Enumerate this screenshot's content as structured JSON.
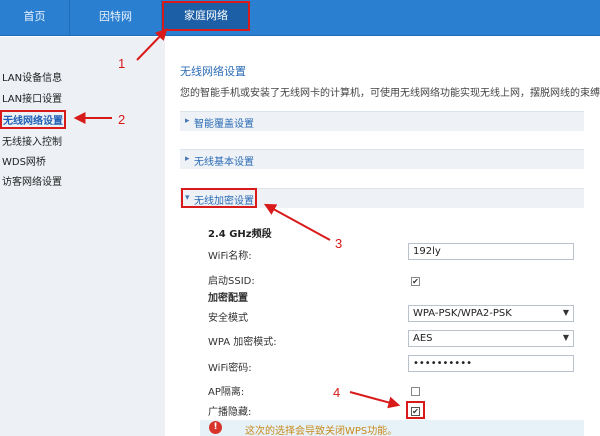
{
  "nav": {
    "tabs": [
      {
        "label": "首页"
      },
      {
        "label": "因特网"
      },
      {
        "label": "家庭网络"
      }
    ]
  },
  "sidebar": {
    "items": [
      {
        "label": "LAN设备信息"
      },
      {
        "label": "LAN接口设置"
      },
      {
        "label": "无线网络设置"
      },
      {
        "label": "无线接入控制"
      },
      {
        "label": "WDS网桥"
      },
      {
        "label": "访客网络设置"
      }
    ]
  },
  "main": {
    "title": "无线网络设置",
    "description": "您的智能手机或安装了无线网卡的计算机，可使用无线网络功能实现无线上网，摆脱网线的束缚。",
    "sections": [
      {
        "label": "智能覆盖设置",
        "chevron": "▸"
      },
      {
        "label": "无线基本设置",
        "chevron": "▸"
      },
      {
        "label": "无线加密设置",
        "chevron": "▾"
      }
    ],
    "band_label": "2.4 GHz频段",
    "fields": {
      "wifi_name_label": "WiFi名称:",
      "wifi_name_value": "192ly",
      "ssid_label": "启动SSID:",
      "ssid_checked": true,
      "encryption_header": "加密配置",
      "security_mode_label": "安全模式",
      "security_mode_value": "WPA-PSK/WPA2-PSK",
      "wpa_mode_label": "WPA 加密模式:",
      "wpa_mode_value": "AES",
      "wifi_password_label": "WiFi密码:",
      "wifi_password_value": "••••••••••",
      "ap_isolation_label": "AP隔离:",
      "ap_isolation_checked": false,
      "broadcast_hide_label": "广播隐藏:",
      "broadcast_hide_checked": true
    },
    "warning": {
      "icon": "!",
      "text": "这次的选择会导致关闭WPS功能。"
    }
  },
  "annotations": {
    "n1": "1",
    "n2": "2",
    "n3": "3",
    "n4": "4"
  },
  "colors": {
    "nav_bg": "#2a7fd0",
    "annotation_red": "#d91a1a",
    "link_blue": "#2a6bb5"
  }
}
